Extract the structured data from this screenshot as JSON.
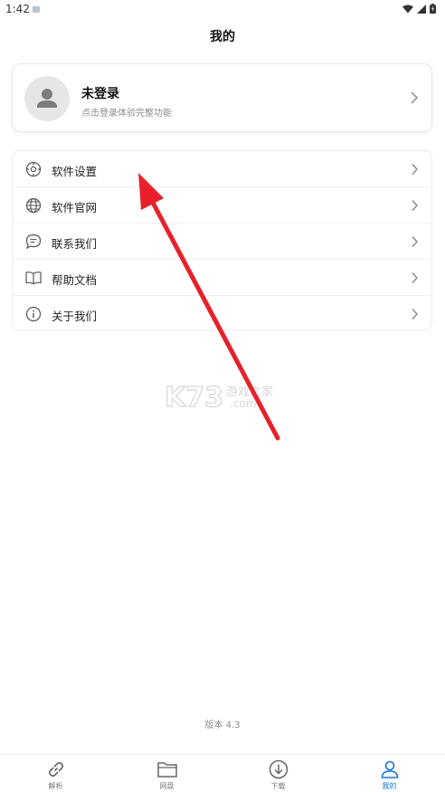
{
  "status_bar": {
    "time": "1:42"
  },
  "header": {
    "title": "我的"
  },
  "profile": {
    "name": "未登录",
    "subtitle": "点击登录体验完整功能"
  },
  "menu": {
    "items": [
      {
        "label": "软件设置",
        "icon": "settings-icon"
      },
      {
        "label": "软件官网",
        "icon": "globe-icon"
      },
      {
        "label": "联系我们",
        "icon": "chat-icon"
      },
      {
        "label": "帮助文档",
        "icon": "book-icon"
      },
      {
        "label": "关于我们",
        "icon": "info-icon"
      }
    ]
  },
  "watermark": {
    "main": "K73",
    "line1": "游戏之家",
    "line2": ".com"
  },
  "footer": {
    "version": "版本 4.3"
  },
  "bottom_nav": {
    "items": [
      {
        "label": "解析",
        "icon": "link-icon"
      },
      {
        "label": "网盘",
        "icon": "folder-icon"
      },
      {
        "label": "下载",
        "icon": "download-icon"
      },
      {
        "label": "我的",
        "icon": "user-icon",
        "active": true
      }
    ]
  },
  "colors": {
    "accent": "#1a73d9",
    "annotation_arrow": "#e8202a"
  }
}
